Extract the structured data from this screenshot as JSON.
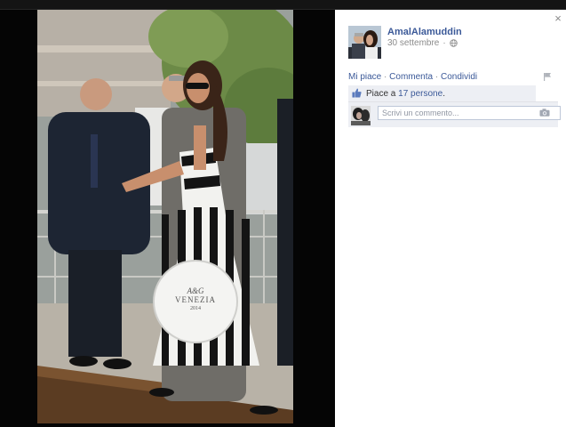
{
  "post": {
    "author": "AmalAlamuddin",
    "date": "30 settembre",
    "privacy_icon": "globe-icon"
  },
  "actions": {
    "like": "Mi piace",
    "comment": "Commenta",
    "share": "Condividi",
    "sep": "·"
  },
  "likes": {
    "prefix": "Piace a",
    "count_text": "17 persone",
    "suffix": "."
  },
  "comment": {
    "placeholder": "Scrivi un commento..."
  },
  "photo": {
    "box_text_line1": "A&G",
    "box_text_line2": "VENEZIA",
    "box_text_line3": "2014"
  },
  "close_glyph": "×",
  "colors": {
    "link": "#3b5998",
    "muted": "#8b8b8b",
    "panel_bg": "#ffffff",
    "stage_bg": "#050505"
  }
}
